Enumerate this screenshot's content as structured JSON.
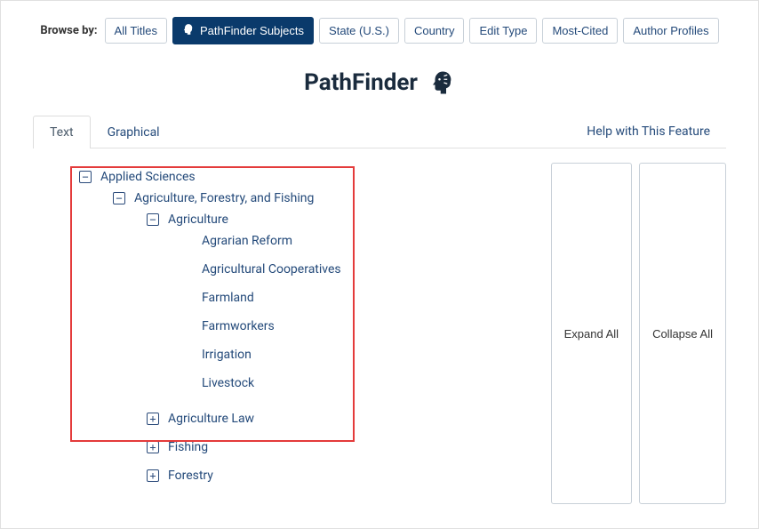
{
  "browse": {
    "label": "Browse by:",
    "filters": [
      {
        "id": "all-titles",
        "label": "All Titles",
        "active": false
      },
      {
        "id": "pathfinder-subjects",
        "label": "PathFinder Subjects",
        "active": true,
        "has_icon": true
      },
      {
        "id": "state-us",
        "label": "State (U.S.)",
        "active": false
      },
      {
        "id": "country",
        "label": "Country",
        "active": false
      },
      {
        "id": "edit-type",
        "label": "Edit Type",
        "active": false
      },
      {
        "id": "most-cited",
        "label": "Most-Cited",
        "active": false
      },
      {
        "id": "author-profiles",
        "label": "Author Profiles",
        "active": false
      }
    ]
  },
  "title": "PathFinder",
  "tabs": {
    "text": "Text",
    "graphical": "Graphical",
    "help": "Help with This Feature"
  },
  "actions": {
    "expand_all": "Expand All",
    "collapse_all": "Collapse All"
  },
  "tree": {
    "root": {
      "label": "Applied Sciences",
      "expanded": true,
      "children": [
        {
          "label": "Agriculture, Forestry, and Fishing",
          "expanded": true,
          "children": [
            {
              "label": "Agriculture",
              "expanded": true,
              "leaves": [
                "Agrarian Reform",
                "Agricultural Cooperatives",
                "Farmland",
                "Farmworkers",
                "Irrigation",
                "Livestock"
              ]
            },
            {
              "label": "Agriculture Law",
              "expanded": false
            },
            {
              "label": "Fishing",
              "expanded": false
            },
            {
              "label": "Forestry",
              "expanded": false
            }
          ]
        }
      ]
    }
  }
}
